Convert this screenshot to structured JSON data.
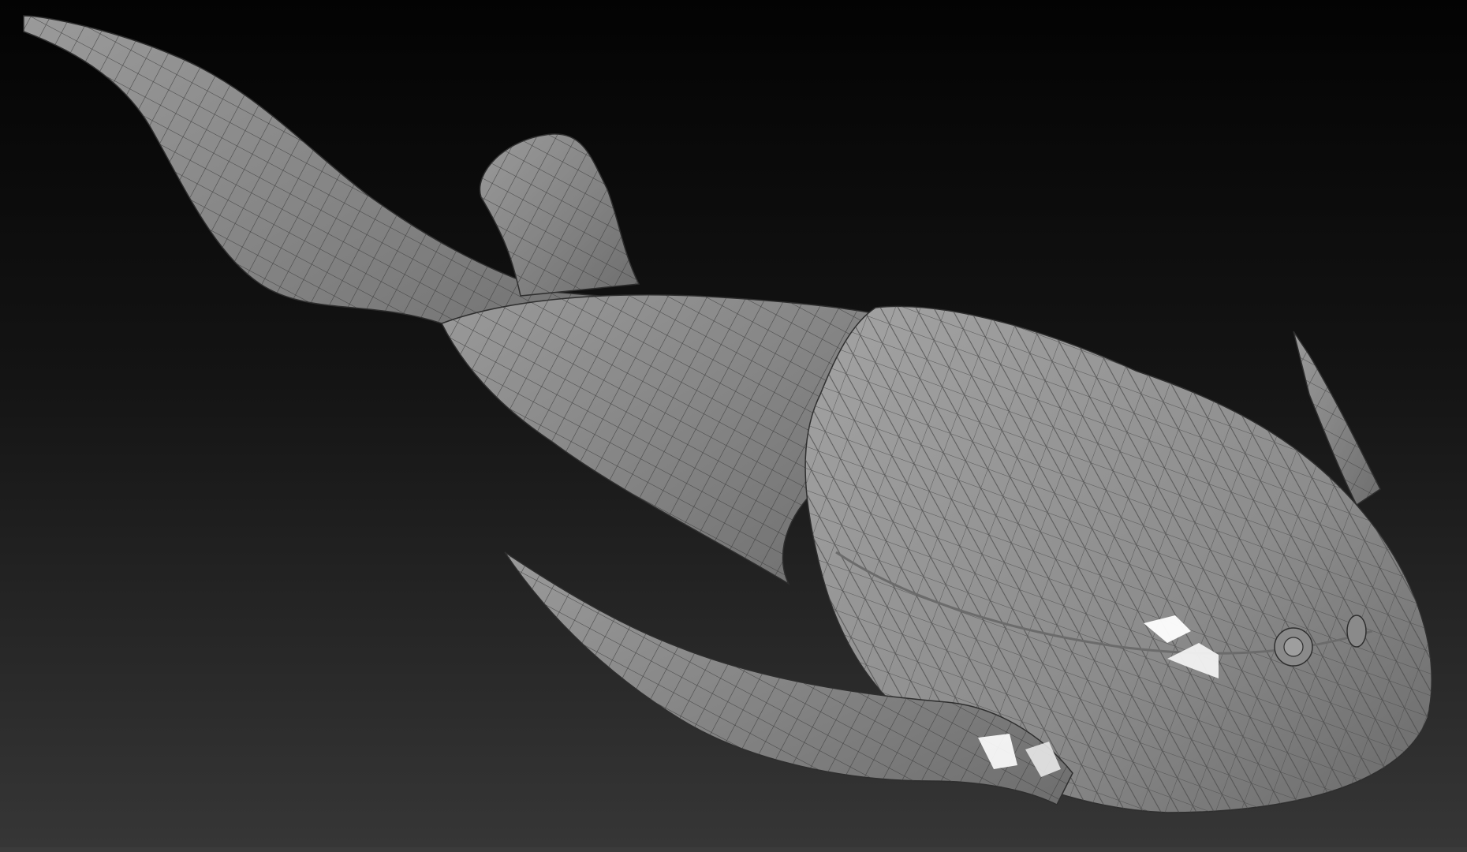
{
  "viewport": {
    "background_top": "#050505",
    "background_bottom": "#333333",
    "model": {
      "name": "fish-creature-mesh",
      "base_color": "#8c8c8c",
      "wire_color": "#3a3a3a",
      "highlight_color": "#ffffff",
      "parts": [
        "tail",
        "dorsal-fin",
        "body",
        "head-shield",
        "left-horn",
        "right-horn",
        "eye-left",
        "eye-right"
      ]
    }
  },
  "status_strip": {
    "color": "#3b3b3b"
  }
}
